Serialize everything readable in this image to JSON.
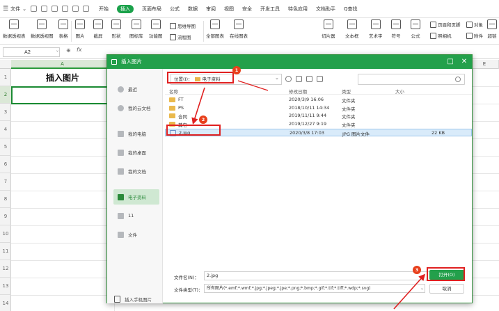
{
  "app": {
    "menu": {
      "file": "文件",
      "tabs": [
        "开始",
        "插入",
        "页面布局",
        "公式",
        "数据",
        "审阅",
        "视图",
        "安全",
        "开发工具",
        "特色应用",
        "文档助手"
      ],
      "active_tab": "插入",
      "search": "Q查找"
    },
    "ribbon": {
      "big_buttons": [
        "数据透视表",
        "数据透视图",
        "表格",
        "图片",
        "截屏",
        "形状",
        "图标库",
        "功能图",
        "全部图表",
        "在线图表",
        "切片器",
        "文本框",
        "艺术字",
        "符号",
        "公式"
      ],
      "small_buttons": [
        "思维导图",
        "流程图",
        "页眉和页脚",
        "对象",
        "照相机",
        "附件",
        "超链"
      ]
    },
    "formula_bar": {
      "cell_ref": "A2",
      "fx": "fx"
    }
  },
  "sheet": {
    "columns": [
      "A",
      "E"
    ],
    "selected_column": "A",
    "rows": [
      "1",
      "2",
      "3",
      "4",
      "5",
      "6",
      "7",
      "8",
      "9",
      "10",
      "11",
      "12",
      "13",
      "14"
    ],
    "selected_row": "2",
    "a1_text": "插入图片"
  },
  "dialog": {
    "title": "插入图片",
    "sidebar": {
      "items": [
        "最近",
        "我的云文档",
        "我的电脑",
        "我的桌面",
        "我的文档",
        "电子资料",
        "11",
        "文件"
      ],
      "active": "电子资料",
      "mobile": "插入手机图片"
    },
    "location": {
      "label": "位置(I)：",
      "folder": "电子资料"
    },
    "columns": {
      "name": "名称",
      "modified": "修改日期",
      "type": "类型",
      "size": "大小"
    },
    "files": [
      {
        "name": "FT",
        "date": "2020/3/9 16:06",
        "type": "文件夹",
        "size": "",
        "kind": "folder"
      },
      {
        "name": "PS",
        "date": "2018/10/11 14:34",
        "type": "文件夹",
        "size": "",
        "kind": "folder"
      },
      {
        "name": "合同",
        "date": "2019/11/11 9:44",
        "type": "文件夹",
        "size": "",
        "kind": "folder"
      },
      {
        "name": "其它",
        "date": "2019/12/27 9:19",
        "type": "文件夹",
        "size": "",
        "kind": "folder"
      },
      {
        "name": "2.jpg",
        "date": "2020/3/8 17:03",
        "type": "JPG 图片文件",
        "size": "22 KB",
        "kind": "image",
        "selected": true
      }
    ],
    "filename": {
      "label": "文件名(N)：",
      "value": "2.jpg"
    },
    "filetype": {
      "label": "文件类型(T)：",
      "value": "所有图片(*.emf;*.wmf;*.jpg;*.jpeg;*.jpe;*.png;*.bmp;*.gif;*.tif;*.tiff;*.wdp;*.svg)"
    },
    "open_label": "打开(O)",
    "cancel_label": "取消"
  },
  "annotations": {
    "badges": [
      "1",
      "2",
      "3"
    ],
    "color": "#e02020"
  }
}
